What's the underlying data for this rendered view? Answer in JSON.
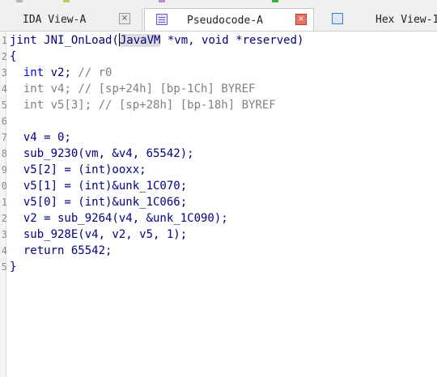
{
  "tabs": [
    {
      "label": "IDA View-A",
      "close": "×"
    },
    {
      "label": "Pseudocode-A",
      "close": "×"
    },
    {
      "label": "Hex View-1"
    }
  ],
  "legend_colors": [
    "#b5b5b5",
    "#c4c45e",
    "#b58ed6",
    "#3cb043"
  ],
  "code": {
    "signature": {
      "ret": "jint",
      "name": " JNI_OnLoad(",
      "highlight": "JavaVM",
      "rest": " *vm, void *reserved)"
    },
    "open_brace": "{",
    "decls": [
      {
        "type": "int",
        "rest": " v2; ",
        "comment": "// r0"
      },
      {
        "type": "int",
        "rest": " v4; ",
        "comment": "// [sp+24h] [bp-1Ch] BYREF"
      },
      {
        "type": "int",
        "rest": " v5[3]; ",
        "comment": "// [sp+28h] [bp-18h] BYREF"
      }
    ],
    "statements": [
      "v4 = 0;",
      "sub_9230(vm, &v4, 65542);",
      "v5[2] = (int)ooxx;",
      "v5[1] = (int)&unk_1C070;",
      "v5[0] = (int)&unk_1C066;",
      "v2 = sub_9264(v4, &unk_1C090);",
      "sub_928E(v4, v2, v5, 1);",
      "return 65542;"
    ],
    "close_brace": "}",
    "line_numbers": [
      "1",
      "2",
      "3",
      "4",
      "5",
      "6",
      "7",
      "8",
      "9",
      "0",
      "1",
      "2",
      "3",
      "4",
      "5"
    ]
  }
}
